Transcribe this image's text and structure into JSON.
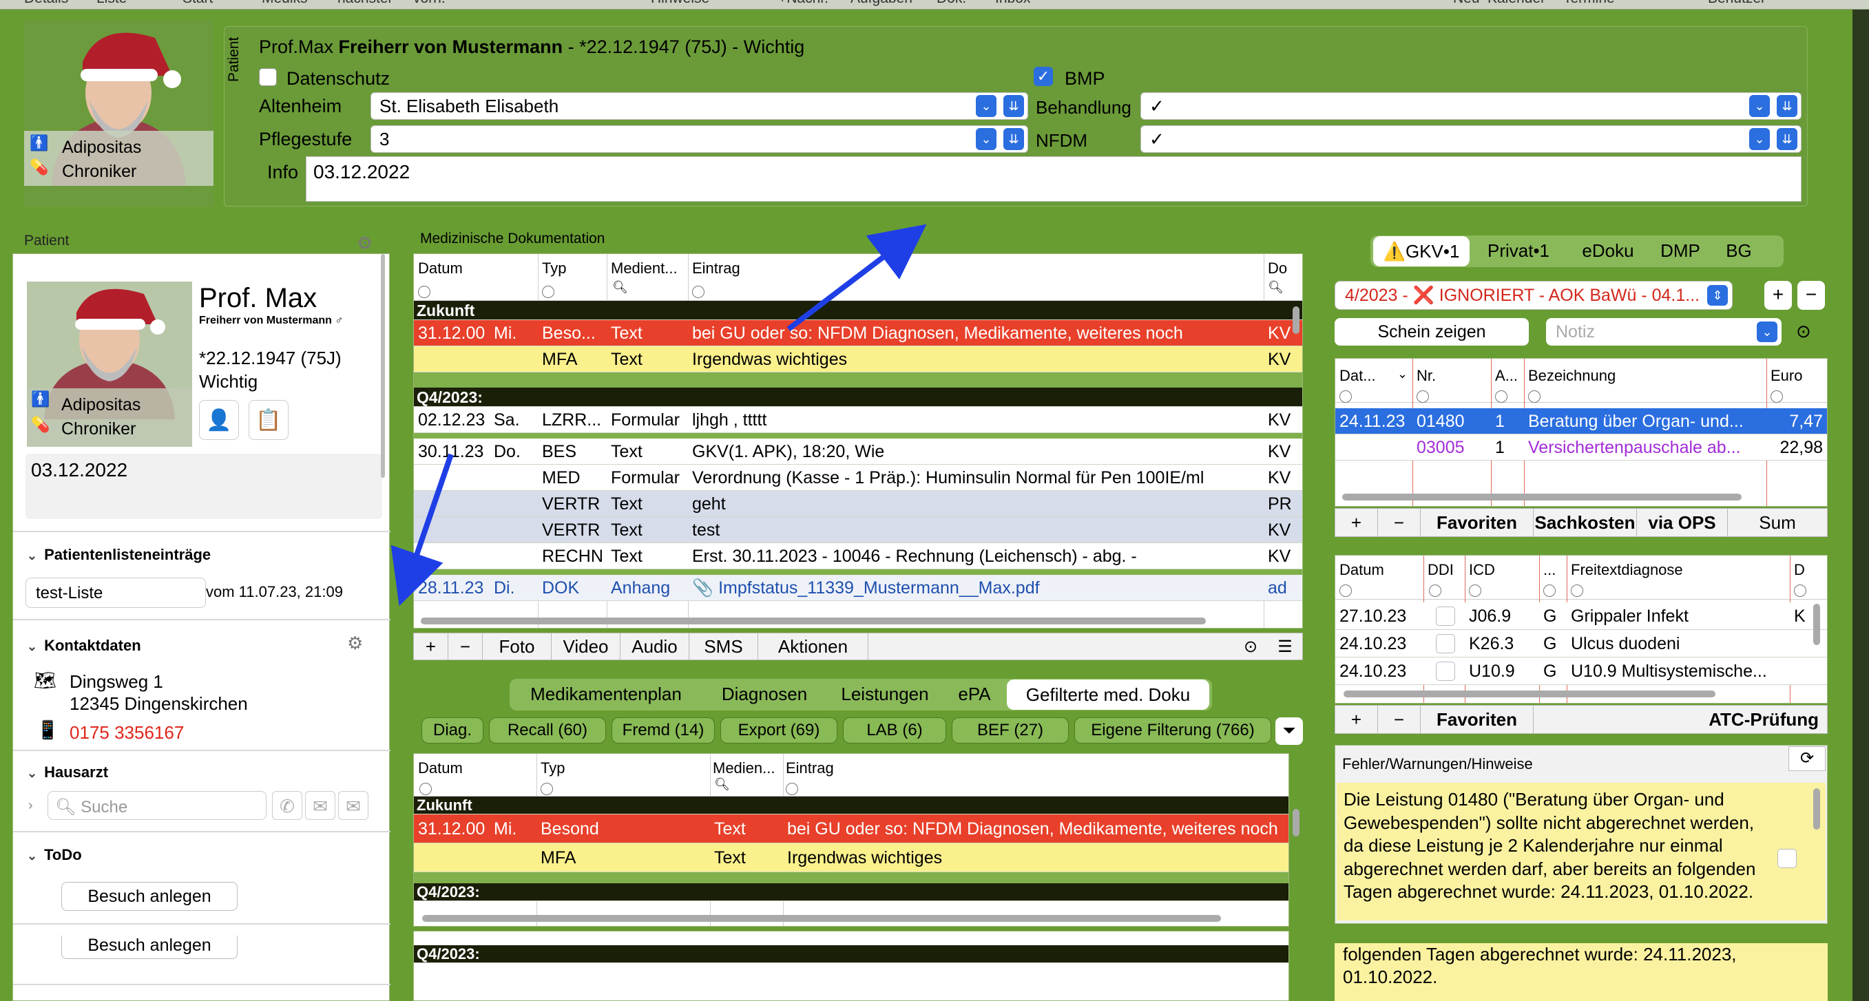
{
  "topbar": {
    "items": [
      "Details",
      "Liste",
      "Start",
      "Mediks",
      "nächster",
      "vorh.",
      "Hinweise",
      "+Nachr.",
      "Aufgaben",
      "Dok.",
      "Inbox",
      "Neu",
      "Kalender",
      "Termine",
      "Benutzer"
    ]
  },
  "header": {
    "vertical_label": "Patient",
    "title_prefix": "Prof.Max ",
    "title_bold": "Freiherr von Mustermann",
    "title_suffix": " - *22.12.1947 (75J) - Wichtig",
    "datenschutz_label": "Datenschutz",
    "bmp_label": "BMP",
    "altenheim_label": "Altenheim",
    "altenheim_value": "St. Elisabeth Elisabeth",
    "behandlung_label": "Behandlung",
    "behandlung_value": "✓",
    "pflegestufe_label": "Pflegestufe",
    "pflegestufe_value": "3",
    "nfdm_label": "NFDM",
    "nfdm_value": "✓",
    "info_label": "Info",
    "info_value": "03.12.2022",
    "avatar_tag1": "Adipositas",
    "avatar_tag2": "Chroniker"
  },
  "patient": {
    "section_label": "Patient",
    "name": "Prof. Max",
    "subname": "Freiherr von Mustermann ♂",
    "birth": "*22.12.1947 (75J)",
    "flag": "Wichtig",
    "avatar_tag1": "Adipositas",
    "avatar_tag2": "Chroniker",
    "note": "03.12.2022",
    "list_section": "Patientenlisteneinträge",
    "list_name": "test-Liste",
    "list_date": "vom  11.07.23, 21:09",
    "contact_section": "Kontaktdaten",
    "street": "Dingsweg 1",
    "city": "12345 Dingenskirchen",
    "phone": "0175 3356167",
    "gp_section": "Hausarzt",
    "search_placeholder": "Suche",
    "todo_section": "ToDo",
    "todo_button": "Besuch anlegen",
    "todo_button2": "Besuch anlegen"
  },
  "doku": {
    "title": "Medizinische Dokumentation",
    "columns": [
      "Datum",
      "Typ",
      "Medient...",
      "Eintrag",
      "Do"
    ],
    "group1": "Zukunft",
    "group2": "Q4/2023:",
    "rows": [
      {
        "date": "31.12.00",
        "day": "Mi.",
        "typ": "Beso...",
        "medium": "Text",
        "entry": "bei GU oder so: NFDM Diagnosen, Medikamente, weiteres noch",
        "do": "KV"
      },
      {
        "date": "",
        "day": "",
        "typ": "MFA",
        "medium": "Text",
        "entry": "Irgendwas wichtiges",
        "do": "KV"
      },
      {
        "date": "02.12.23",
        "day": "Sa.",
        "typ": "LZRR...",
        "medium": "Formular",
        "entry": "ljhgh , ttttt",
        "do": "KV"
      },
      {
        "date": "30.11.23",
        "day": "Do.",
        "typ": "BES",
        "medium": "Text",
        "entry": "GKV(1. APK), 18:20, Wie",
        "do": "KV"
      },
      {
        "date": "",
        "day": "",
        "typ": "MED",
        "medium": "Formular",
        "entry": "Verordnung (Kasse - 1 Präp.): Huminsulin Normal für Pen 100IE/ml",
        "do": "KV"
      },
      {
        "date": "",
        "day": "",
        "typ": "VERTR",
        "medium": "Text",
        "entry": "geht",
        "do": "PR"
      },
      {
        "date": "",
        "day": "",
        "typ": "VERTR",
        "medium": "Text",
        "entry": "test",
        "do": "KV"
      },
      {
        "date": "",
        "day": "",
        "typ": "RECHN",
        "medium": "Text",
        "entry": "Erst. 30.11.2023 - 10046 - Rechnung (Leichensch) - abg. -",
        "do": "KV"
      },
      {
        "date": "28.11.23",
        "day": "Di.",
        "typ": "DOK",
        "medium": "Anhang",
        "entry": "📎 Impfstatus_11339_Mustermann__Max.pdf",
        "do": "ad"
      }
    ],
    "toolbar": [
      "+",
      "−",
      "Foto",
      "Video",
      "Audio",
      "SMS",
      "Aktionen"
    ]
  },
  "lower": {
    "tabs": [
      "Medikamentenplan",
      "Diagnosen",
      "Leistungen",
      "ePA",
      "Gefilterte med. Doku"
    ],
    "filters": [
      "Diag.",
      "Recall (60)",
      "Fremd (14)",
      "Export (69)",
      "LAB (6)",
      "BEF (27)",
      "Eigene Filterung (766)"
    ],
    "columns": [
      "Datum",
      "Typ",
      "Medien...",
      "Eintrag"
    ],
    "group1": "Zukunft",
    "group2": "Q4/2023:",
    "group3": "Q4/2023:",
    "rows": [
      {
        "date": "31.12.00",
        "day": "Mi.",
        "typ": "Besond",
        "medium": "Text",
        "entry": "bei GU oder so: NFDM Diagnosen, Medikamente, weiteres noch"
      },
      {
        "date": "",
        "day": "",
        "typ": "MFA",
        "medium": "Text",
        "entry": "Irgendwas wichtiges"
      }
    ]
  },
  "billing": {
    "tabs": [
      "GKV•1",
      "Privat•1",
      "eDoku",
      "DMP",
      "BG"
    ],
    "quarter": "4/2023 - ❌ IGNORIERT - AOK BaWü - 04.1...",
    "schein_button": "Schein zeigen",
    "notiz_placeholder": "Notiz",
    "columns": [
      "Dat...",
      "Nr.",
      "A...",
      "Bezeichnung",
      "Euro"
    ],
    "rows": [
      {
        "date": "24.11.23",
        "nr": "01480",
        "a": "1",
        "bez": "Beratung über Organ- und...",
        "euro": "7,47"
      },
      {
        "date": "",
        "nr": "03005",
        "a": "1",
        "bez": "Versichertenpauschale ab...",
        "euro": "22,98"
      }
    ],
    "toolbar": [
      "+",
      "−",
      "Favoriten",
      "Sachkosten",
      "via OPS",
      "Sum"
    ]
  },
  "diagnoses": {
    "columns": [
      "Datum",
      "DDI",
      "ICD",
      "...",
      "Freitextdiagnose",
      "D"
    ],
    "rows": [
      {
        "date": "27.10.23",
        "icd": "J06.9",
        "g": "G",
        "text": "Grippaler Infekt",
        "d": "K"
      },
      {
        "date": "24.10.23",
        "icd": "K26.3",
        "g": "G",
        "text": "Ulcus duodeni",
        "d": ""
      },
      {
        "date": "24.10.23",
        "icd": "U10.9",
        "g": "G",
        "text": "U10.9 Multisystemische...",
        "d": ""
      }
    ],
    "toolbar": [
      "+",
      "−",
      "Favoriten",
      "ATC-Prüfung"
    ]
  },
  "warnings": {
    "title": "Fehler/Warnungen/Hinweise",
    "text": "Die Leistung 01480 (\"Beratung über Organ- und Gewebespenden\") sollte nicht abgerechnet werden, da diese Leistung je 2 Kalenderjahre nur einmal abgerechnet werden darf, aber bereits an folgenden Tagen abgerechnet wurde: 24.11.2023, 01.10.2022.",
    "overflow_text1": "folgenden Tagen abgerechnet wurde: 24.11.2023,",
    "overflow_text2": "01.10.2022."
  },
  "colors": {
    "background": "#689d32",
    "accent": "#2a6ee0",
    "row_red": "#e8402a",
    "row_yellow": "#faf08c",
    "selected": "#2a6ee0",
    "arrow": "#1f3fe6"
  }
}
